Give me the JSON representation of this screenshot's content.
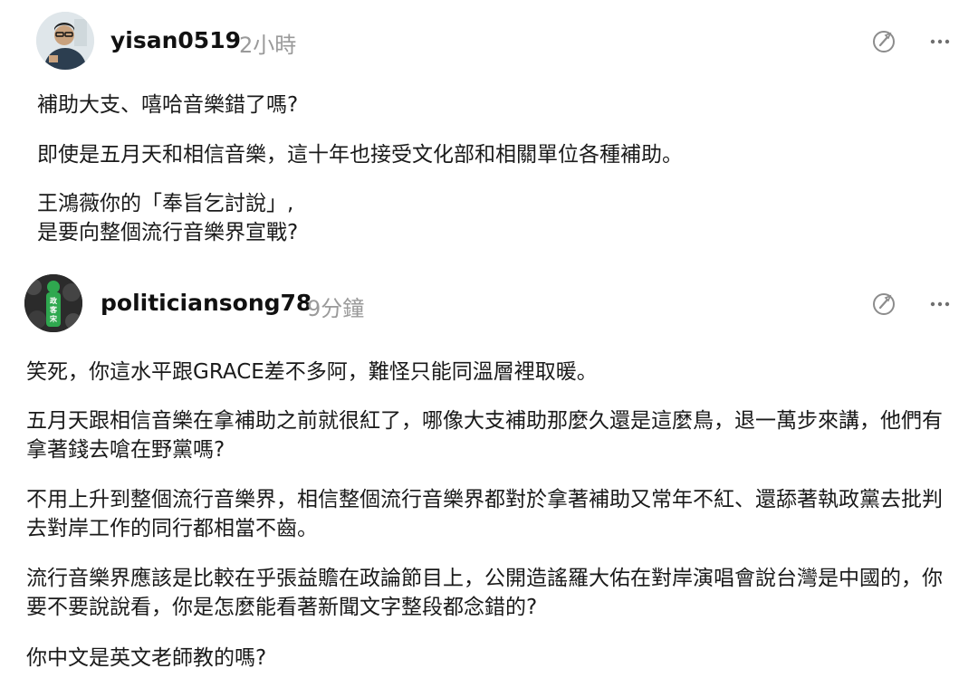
{
  "posts": [
    {
      "username": "yisan0519",
      "time": "2小時",
      "paragraphs": [
        "補助大支、嘻哈音樂錯了嗎?",
        "即使是五月天和相信音樂，這十年也接受文化部和相關單位各種補助。",
        "王鴻薇你的「奉旨乞討說」,\n是要向整個流行音樂界宣戰?"
      ]
    },
    {
      "username": "politiciansong78",
      "time": "9分鐘",
      "avatar_text": [
        "政",
        "客",
        "宋"
      ],
      "paragraphs": [
        "笑死，你這水平跟GRACE差不多阿，難怪只能同溫層裡取暖。",
        "五月天跟相信音樂在拿補助之前就很紅了，哪像大支補助那麼久還是這麼鳥，退一萬步來講，他們有拿著錢去嗆在野黨嗎?",
        "不用上升到整個流行音樂界，相信整個流行音樂界都對於拿著補助又常年不紅、還舔著執政黨去批判去對岸工作的同行都相當不齒。",
        "流行音樂界應該是比較在乎張益贍在政論節目上，公開造謠羅大佑在對岸演唱會說台灣是中國的，你要不要說說看，你是怎麼能看著新聞文字整段都念錯的?",
        "你中文是英文老師教的嗎?"
      ]
    }
  ],
  "icons": {
    "edit": "edit-quote-icon",
    "more": "more-options-icon"
  },
  "colors": {
    "avatar_badge": "#2fa84f",
    "muted": "#9a9a9a",
    "icon": "#8c8c8c"
  }
}
